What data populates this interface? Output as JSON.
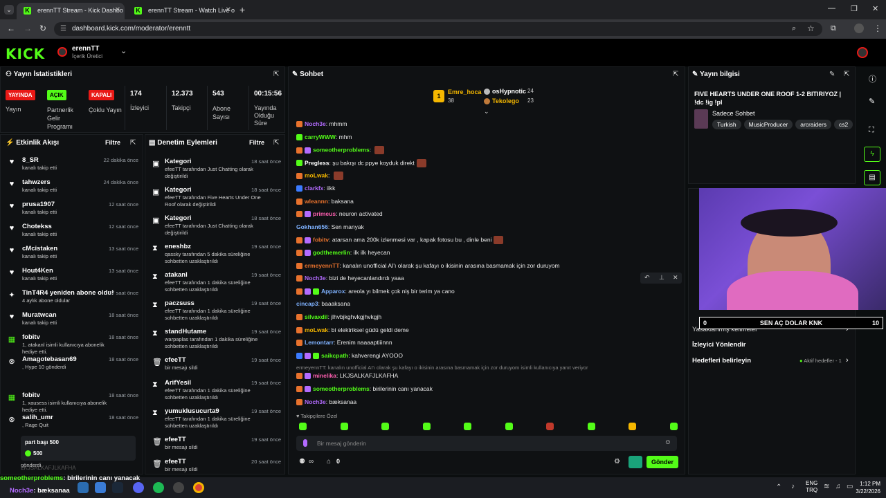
{
  "browser": {
    "tabs": [
      {
        "label": "erennTT Stream - Kick Dashbo",
        "active": true
      },
      {
        "label": "erennTT Stream - Watch Live o",
        "active": false
      }
    ],
    "url": "dashboard.kick.com/moderator/erenntt"
  },
  "header": {
    "logo": "KICK",
    "channel_name": "erennTT",
    "channel_role": "İçerik Üretici"
  },
  "stats": {
    "title": "Yayın İstatistikleri",
    "badges": [
      {
        "badge": "YAYINDA",
        "label": "Yayın",
        "color": "#e91916"
      },
      {
        "badge": "AÇIK",
        "label": "Partnerlik Gelir Programı",
        "color": "#53fc18"
      },
      {
        "badge": "KAPALI",
        "label": "Çoklu Yayın",
        "color": "#e91916"
      }
    ],
    "metrics": [
      {
        "value": "174",
        "label": "İzleyici"
      },
      {
        "value": "12.373",
        "label": "Takipçi"
      },
      {
        "value": "543",
        "label": "Abone Sayısı"
      },
      {
        "value": "00:15:56",
        "label": "Yayında Olduğu Süre"
      }
    ]
  },
  "activity": {
    "title": "Etkinlik Akışı",
    "filter": "Filtre",
    "items": [
      {
        "name": "8_SR",
        "sub": "kanalı takip etti",
        "time": "22 dakika önce",
        "icon": "heart-icon"
      },
      {
        "name": "tahwzers",
        "sub": "kanalı takip etti",
        "time": "24 dakika önce",
        "icon": "heart-icon"
      },
      {
        "name": "prusa1907",
        "sub": "kanalı takip etti",
        "time": "12 saat önce",
        "icon": "heart-icon"
      },
      {
        "name": "Chotekss",
        "sub": "kanalı takip etti",
        "time": "12 saat önce",
        "icon": "heart-icon"
      },
      {
        "name": "cMcistaken",
        "sub": "kanalı takip etti",
        "time": "13 saat önce",
        "icon": "heart-icon"
      },
      {
        "name": "Hout4Ken",
        "sub": "kanalı takip etti",
        "time": "13 saat önce",
        "icon": "heart-icon"
      },
      {
        "name": "TinT4R4 yeniden abone oldu!",
        "sub": "4 aylık abone oldular",
        "time": "17 saat önce",
        "icon": "star-icon"
      },
      {
        "name": "Muratwcan",
        "sub": "kanalı takip etti",
        "time": "18 saat önce",
        "icon": "heart-icon"
      },
      {
        "name": "fobitv",
        "sub": "1, atakanl isimli kullanıcıya abonelik hediye etti.",
        "time": "18 saat önce",
        "icon": "gift-icon"
      },
      {
        "name": "Amagotebasan69",
        "sub": ", Hype 10 gönderdi",
        "time": "18 saat önce",
        "icon": "close-circle-icon"
      },
      {
        "name": "fobitv",
        "sub": "1, xausess isimli kullanıcıya abonelik hediye etti.",
        "time": "18 saat önce",
        "icon": "gift-icon"
      },
      {
        "name": "salih_umr",
        "sub": ", Rage Quit",
        "time": "18 saat önce",
        "icon": "close-circle-icon"
      }
    ],
    "tip": {
      "text": "part başı 500",
      "amount": "500",
      "suffix": "gönderdi"
    }
  },
  "moderation": {
    "title": "Denetim Eylemleri",
    "filter": "Filtre",
    "items": [
      {
        "name": "Kategori",
        "sub": "efeeTT tarafından Just Chatting olarak değiştirildi",
        "time": "18 saat önce",
        "icon": "category-icon"
      },
      {
        "name": "Kategori",
        "sub": "efeeTT tarafından Five Hearts Under One Roof olarak değiştirildi",
        "time": "18 saat önce",
        "icon": "category-icon"
      },
      {
        "name": "Kategori",
        "sub": "efeeTT tarafından Just Chatting olarak değiştirildi",
        "time": "18 saat önce",
        "icon": "category-icon"
      },
      {
        "name": "eneshbz",
        "sub": "qassky tarafından 5 dakika süreliğine sohbetten uzaklaştırıldı",
        "time": "19 saat önce",
        "icon": "hourglass-icon"
      },
      {
        "name": "atakanl",
        "sub": "efeeTT tarafından 1 dakika süreliğine sohbetten uzaklaştırıldı",
        "time": "19 saat önce",
        "icon": "hourglass-icon"
      },
      {
        "name": "paczsuss",
        "sub": "efeeTT tarafından 1 dakika süreliğine sohbetten uzaklaştırıldı",
        "time": "19 saat önce",
        "icon": "hourglass-icon"
      },
      {
        "name": "standHutame",
        "sub": "warpaplas tarafından 1 dakika süreliğine sohbetten uzaklaştırıldı",
        "time": "19 saat önce",
        "icon": "hourglass-icon"
      },
      {
        "name": "efeeTT",
        "sub": "bir mesajı sildi",
        "time": "19 saat önce",
        "icon": "trash-icon"
      },
      {
        "name": "ArifYesil",
        "sub": "efeeTT tarafından 1 dakika süreliğine sohbetten uzaklaştırıldı",
        "time": "19 saat önce",
        "icon": "hourglass-icon"
      },
      {
        "name": "yumuklusucurta9",
        "sub": "efeeTT tarafından 1 dakika süreliğine sohbetten uzaklaştırıldı",
        "time": "19 saat önce",
        "icon": "hourglass-icon"
      },
      {
        "name": "efeeTT",
        "sub": "bir mesajı sildi",
        "time": "19 saat önce",
        "icon": "trash-icon"
      },
      {
        "name": "efeeTT",
        "sub": "bir mesajı sildi",
        "time": "20 saat önce",
        "icon": "trash-icon"
      }
    ]
  },
  "chat": {
    "title": "Sohbet",
    "leaders": [
      {
        "name": "Emre_hoca",
        "value": "38"
      },
      {
        "name": "osHypnotic",
        "value": "24"
      },
      {
        "name": "Tekolego",
        "value": "23"
      }
    ],
    "messages": [
      {
        "user": "Noch3e",
        "text": "mhmm",
        "color": "#b36bff",
        "badges": [
          "o"
        ]
      },
      {
        "user": "carryWWW",
        "text": "mhm",
        "color": "#53fc18",
        "badges": [
          "g"
        ]
      },
      {
        "user": "someotherproblems",
        "text": "",
        "color": "#53fc18",
        "badges": [
          "o",
          "p"
        ],
        "emote": true
      },
      {
        "user": "Pregless",
        "text": "şu bakışı dc ppye koyduk direkt",
        "color": "#ffffff",
        "badges": [
          "g"
        ],
        "emote": true
      },
      {
        "user": "moLwak",
        "text": "",
        "color": "#f5b700",
        "badges": [
          "o"
        ],
        "emote": true
      },
      {
        "user": "clarkfx",
        "text": "iikk",
        "color": "#b36bff",
        "badges": [
          "b"
        ]
      },
      {
        "user": "wleannn",
        "text": "baksana",
        "color": "#e8722d",
        "badges": [
          "o"
        ]
      },
      {
        "user": "primeus",
        "text": "neuron activated",
        "color": "#ff5fb0",
        "badges": [
          "o",
          "p"
        ]
      },
      {
        "user": "Gokhan656",
        "text": "Sen manyak",
        "color": "#7fb2ff",
        "badges": []
      },
      {
        "user": "fobitv",
        "text": "atarsan ama 200k izlenmesi var , kapak fotosu bu , dinle beni",
        "color": "#e8722d",
        "badges": [
          "o",
          "p"
        ],
        "emote": true
      },
      {
        "user": "godthemerlin",
        "text": "ilk ilk heyecan",
        "color": "#53fc18",
        "badges": [
          "o",
          "p"
        ]
      },
      {
        "user": "ermeyennTT",
        "text": "kanalın unofficial AI'ı olarak şu kafayı o ikisinin arasına basmamak için zor duruyom",
        "color": "#e8722d",
        "badges": [
          "o"
        ]
      },
      {
        "user": "Noch3e",
        "text": "bizi de heyecanlandırdı yaaa",
        "color": "#b36bff",
        "badges": [
          "o"
        ]
      },
      {
        "user": "Apparox",
        "text": "areola yı bilmek çok niş bir terim ya cano",
        "color": "#7fb2ff",
        "badges": [
          "o",
          "p",
          "g"
        ]
      },
      {
        "user": "cincap3",
        "text": "baaaksana",
        "color": "#7fb2ff",
        "badges": []
      },
      {
        "user": "silvaxdil",
        "text": "jlhvbjkghvkgjhvkgjh",
        "color": "#53fc18",
        "badges": [
          "o"
        ]
      },
      {
        "user": "moLwak",
        "text": "bi elektriksel güdü geldi deme",
        "color": "#f5b700",
        "badges": [
          "o"
        ]
      },
      {
        "user": "Lemontarr",
        "text": "Erenim naaaaptiiinnn",
        "color": "#7fb2ff",
        "badges": [
          "o"
        ]
      },
      {
        "user": "saikcpath",
        "text": "kahverengi AYOOO",
        "color": "#53fc18",
        "badges": [
          "b",
          "p",
          "g"
        ]
      }
    ],
    "reply_context": "ermeyennTT: kanalın unofficial AI'ı olarak şu kafayı o ikisinin arasına basmamak için zor duruyom isimli kullanıcıya yanıt veriyor",
    "messages_after": [
      {
        "user": "minelika",
        "text": "LKJSALKAFJLKAFHA",
        "color": "#ff5fb0",
        "badges": [
          "o",
          "p"
        ]
      },
      {
        "user": "someotherproblems",
        "text": "birilerinin canı yanacak",
        "color": "#53fc18",
        "badges": [
          "o",
          "p"
        ]
      },
      {
        "user": "Noch3e",
        "text": "bæksanaa",
        "color": "#b36bff",
        "badges": [
          "o"
        ]
      }
    ],
    "followers_only": "Takipçilere Özel",
    "input_placeholder": "Bir mesaj gönderin",
    "infinity_label": "∞",
    "count_label": "0",
    "send": "Gönder"
  },
  "stream_info": {
    "title": "Yayın bilgisi",
    "stream_title": "FIVE HEARTS UNDER ONE ROOF 1-2 BITIRIYOZ | !dc !ig !pl",
    "category": "Sadece Sohbet",
    "tags": [
      "Turkish",
      "MusicProducer",
      "arcraiders",
      "cs2"
    ],
    "rows": [
      "Yasaklanmış kelimeler",
      "İzleyici Yönlendir",
      "Hedefleri belirleyin"
    ],
    "goals_status": "Aktif hedefler - 1",
    "goal_bar": {
      "start": "0",
      "label": "SEN AÇ DOLAR KNK",
      "end": "10"
    }
  },
  "overlay": {
    "line1_user": "someotherproblems",
    "line1_text": ": birilerinin canı yanacak",
    "line2_user": "Noch3e",
    "line2_text": ": bæksanaa",
    "ghost": "LKJSALKAFJLKAFHA"
  },
  "taskbar": {
    "lang1": "ENG",
    "lang2": "TRQ",
    "time": "1:12 PM",
    "date": "3/22/2026"
  }
}
